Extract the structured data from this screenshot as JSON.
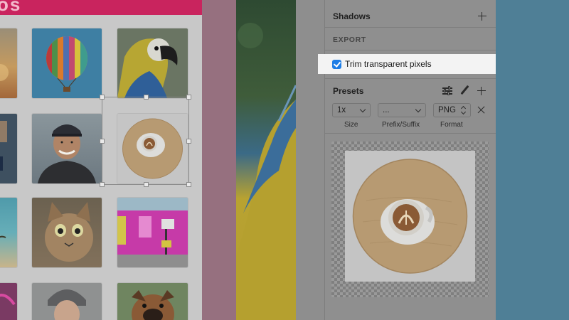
{
  "artboard": {
    "header_text": "os"
  },
  "inspector": {
    "shadows_label": "Shadows",
    "export_label": "EXPORT",
    "trim_transparent_label": "Trim transparent pixels",
    "trim_transparent_checked": true,
    "presets_label": "Presets",
    "size": {
      "value": "1x",
      "label": "Size"
    },
    "prefix_suffix": {
      "value": "...",
      "label": "Prefix/Suffix"
    },
    "format": {
      "value": "PNG",
      "label": "Format"
    }
  },
  "colors": {
    "accent_checkbox": "#1e7de6",
    "highlight_bar": "#72b7d8",
    "artboard_header": "#c9245e",
    "desktop": "#4f7f96"
  },
  "icons": [
    "plus-icon",
    "sliders-icon",
    "pen-icon",
    "close-icon",
    "chevron-down-icon",
    "stepper-icon",
    "checkmark-icon"
  ]
}
